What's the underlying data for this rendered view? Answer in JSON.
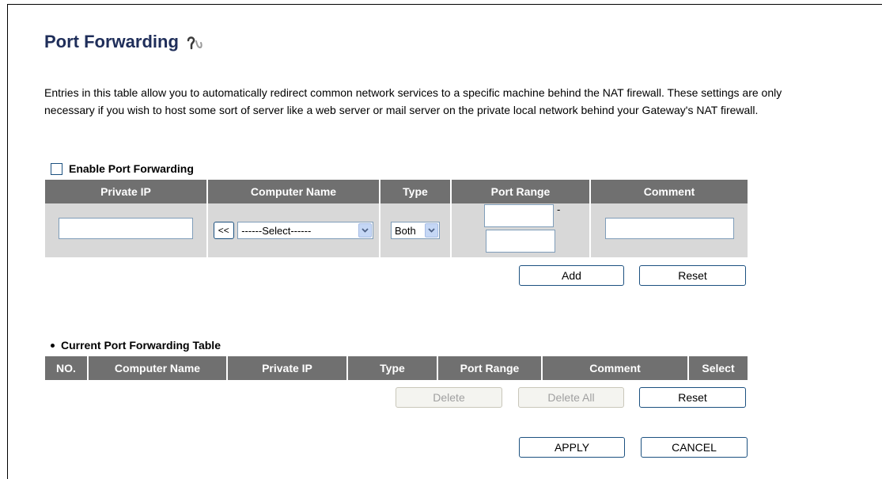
{
  "page": {
    "title": "Port Forwarding",
    "description": "Entries in this table allow you to automatically redirect common network services to a specific machine behind the NAT firewall. These settings are only necessary if you wish to host some sort of server like a web server or mail server on the private local network behind your Gateway's NAT firewall."
  },
  "enable": {
    "label": "Enable Port Forwarding",
    "checked": false
  },
  "entry_table": {
    "headers": [
      "Private IP",
      "Computer Name",
      "Type",
      "Port Range",
      "Comment"
    ],
    "private_ip_value": "",
    "copy_button_label": "<<",
    "computer_select_value": "------Select------",
    "type_select_value": "Both",
    "port_from_value": "",
    "port_separator": "-",
    "port_to_value": "",
    "comment_value": ""
  },
  "entry_buttons": {
    "add": "Add",
    "reset": "Reset"
  },
  "current_table": {
    "title": "Current Port Forwarding Table",
    "headers": [
      "NO.",
      "Computer Name",
      "Private IP",
      "Type",
      "Port Range",
      "Comment",
      "Select"
    ]
  },
  "current_buttons": {
    "delete": "Delete",
    "delete_all": "Delete All",
    "reset": "Reset"
  },
  "footer_buttons": {
    "apply": "APPLY",
    "cancel": "CANCEL"
  }
}
